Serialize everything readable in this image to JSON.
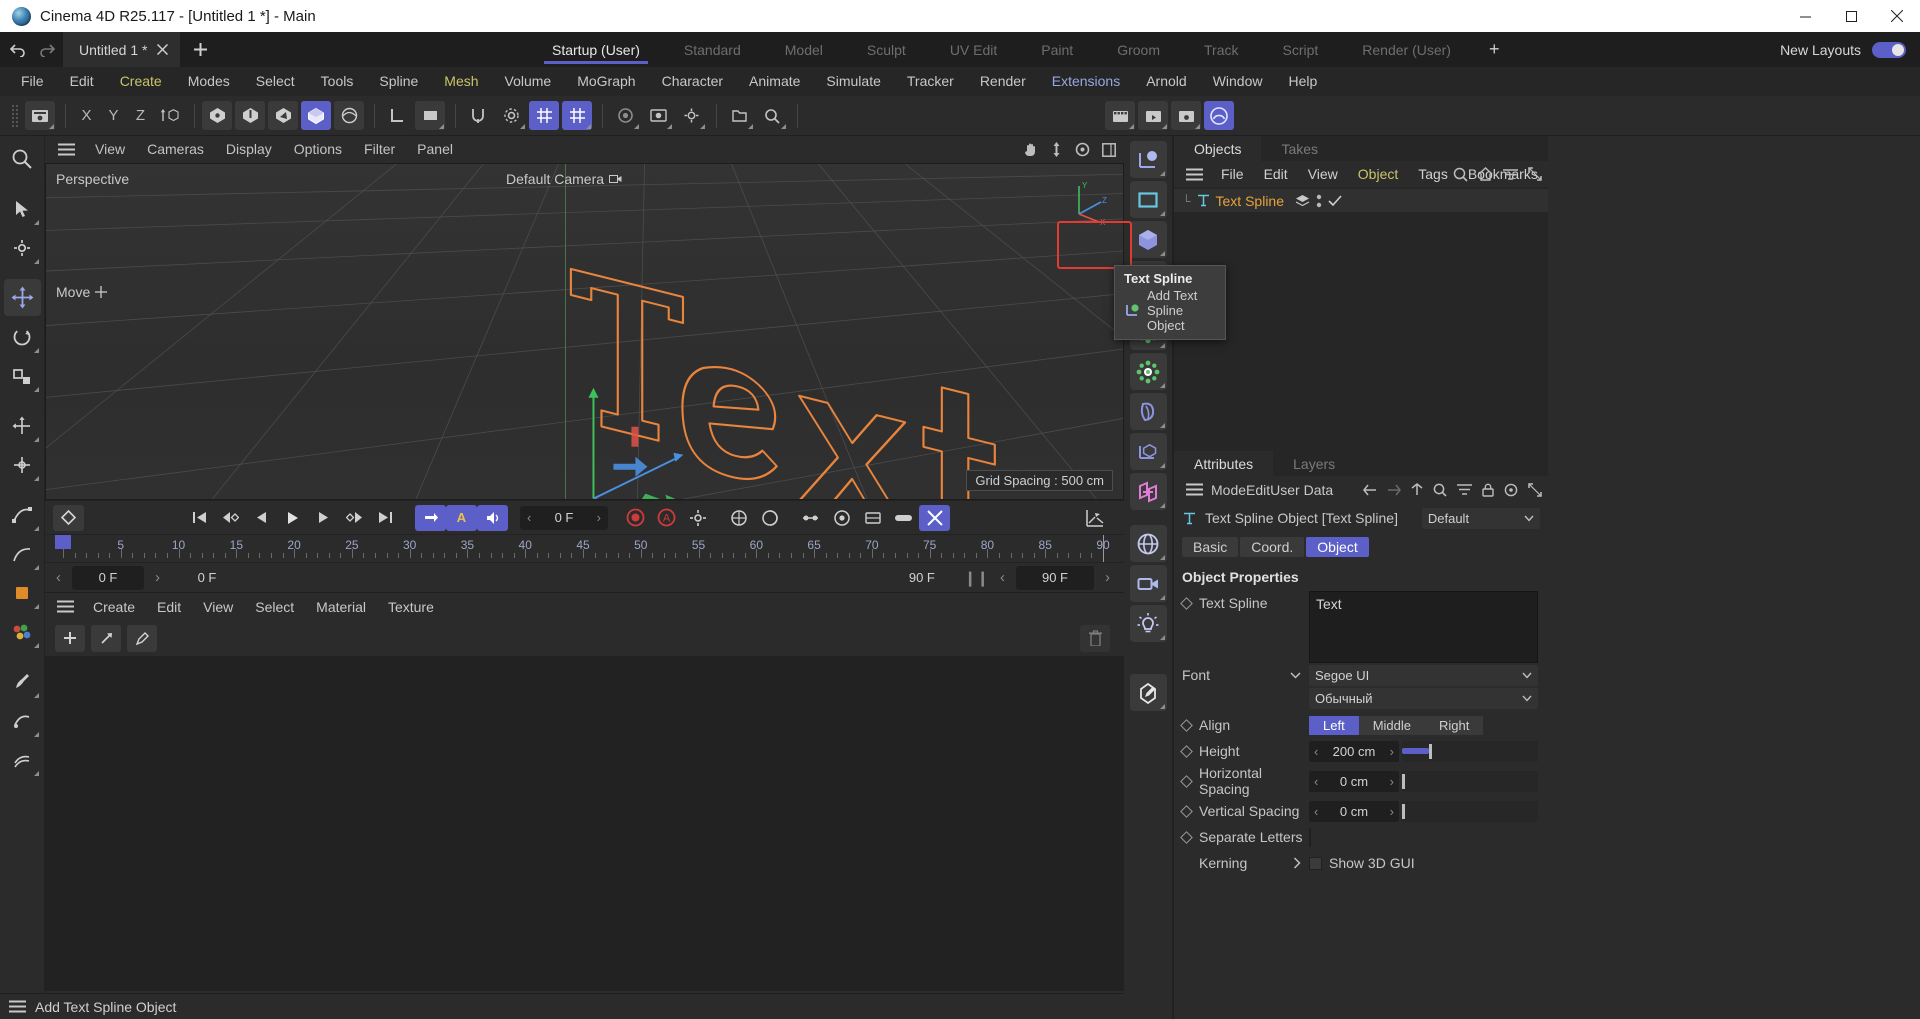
{
  "window": {
    "title": "Cinema 4D R25.117 - [Untitled 1 *] - Main",
    "logo_icon": "cinema4d-logo-icon",
    "minimize_icon": "minimize-icon",
    "maximize_icon": "maximize-icon",
    "close_icon": "close-icon"
  },
  "tabrow": {
    "undo_icon": "undo-icon",
    "redo_icon": "redo-icon",
    "document_tab": "Untitled 1 *",
    "document_close_icon": "close-icon",
    "new_tab_label": "+",
    "layouts": [
      {
        "label": "Startup (User)",
        "active": true
      },
      {
        "label": "Standard",
        "active": false
      },
      {
        "label": "Model",
        "active": false
      },
      {
        "label": "Sculpt",
        "active": false
      },
      {
        "label": "UV Edit",
        "active": false
      },
      {
        "label": "Paint",
        "active": false
      },
      {
        "label": "Groom",
        "active": false
      },
      {
        "label": "Track",
        "active": false
      },
      {
        "label": "Script",
        "active": false
      },
      {
        "label": "Render (User)",
        "active": false
      }
    ],
    "add_layout_label": "+",
    "new_layouts_label": "New Layouts",
    "toggle_on": true
  },
  "menubar": {
    "items": [
      {
        "label": "File",
        "color": "#c8c8c8"
      },
      {
        "label": "Edit",
        "color": "#c8c8c8"
      },
      {
        "label": "Create",
        "color": "#c9c46a"
      },
      {
        "label": "Modes",
        "color": "#c8c8c8"
      },
      {
        "label": "Select",
        "color": "#c8c8c8"
      },
      {
        "label": "Tools",
        "color": "#c8c8c8"
      },
      {
        "label": "Spline",
        "color": "#c8c8c8"
      },
      {
        "label": "Mesh",
        "color": "#c9c46a"
      },
      {
        "label": "Volume",
        "color": "#c8c8c8"
      },
      {
        "label": "MoGraph",
        "color": "#c8c8c8"
      },
      {
        "label": "Character",
        "color": "#c8c8c8"
      },
      {
        "label": "Animate",
        "color": "#c8c8c8"
      },
      {
        "label": "Simulate",
        "color": "#c8c8c8"
      },
      {
        "label": "Tracker",
        "color": "#c8c8c8"
      },
      {
        "label": "Render",
        "color": "#c8c8c8"
      },
      {
        "label": "Extensions",
        "color": "#9aa7e0"
      },
      {
        "label": "Arnold",
        "color": "#c8c8c8"
      },
      {
        "label": "Window",
        "color": "#c8c8c8"
      },
      {
        "label": "Help",
        "color": "#c8c8c8"
      }
    ]
  },
  "maintoolbar": {
    "axis_labels": [
      "X",
      "Y",
      "Z"
    ],
    "icons": [
      "undo-redo-icon",
      "live-selection-icon",
      "x-axis-lock",
      "y-axis-lock",
      "z-axis-lock",
      "world-object-axis-icon",
      "point-mode-icon",
      "edge-mode-icon",
      "polygon-mode-icon",
      "model-mode-icon",
      "texture-mode-icon",
      "workplane-icon",
      "locked-workplane-icon",
      "enable-axis-icon",
      "enable-snap-icon",
      "grid-snap-icon",
      "workplane-snap-icon",
      "render-view-icon",
      "render-to-picture-viewer-icon",
      "render-settings-icon",
      "content-browser-icon",
      "asset-browser-icon",
      "scene-nodes-icon",
      "add-render-icon",
      "render-queue-icon",
      "render-settings-gear-icon",
      "cineware-icon"
    ]
  },
  "viewport": {
    "menu": [
      "View",
      "Cameras",
      "Display",
      "Options",
      "Filter",
      "Panel"
    ],
    "hamburger_icon": "hamburger-icon",
    "right_icons": [
      "pan-icon",
      "dolly-icon",
      "rotate-icon",
      "maximize-viewport-icon"
    ],
    "label_top_left": "Perspective",
    "label_camera": "Default Camera",
    "camera_icon": "camera-icon",
    "move_label": "Move",
    "move_icon": "move-crosshair-icon",
    "grid_spacing": "Grid Spacing : 500 cm",
    "axis_labels": {
      "x": "X",
      "y": "Y",
      "z": "Z"
    },
    "text_object": "Text"
  },
  "timeline": {
    "keyframe_icon": "keyframe-diamond-icon",
    "transport_icons": [
      "go-to-start-icon",
      "go-to-previous-key-icon",
      "go-to-previous-frame-icon",
      "play-icon",
      "go-to-next-frame-icon",
      "go-to-next-key-icon",
      "go-to-end-icon"
    ],
    "loop_icon": "loop-icon",
    "autokey_letter": "A",
    "sound_icon": "sound-icon",
    "current_frame": "0 F",
    "record_icon": "record-active-objects-icon",
    "autokeying_icon": "autokeying-icon",
    "keyframe_settings_icon": "keyframe-settings-icon",
    "position_icon": "position-icon",
    "rotation_icon": "rotation-icon",
    "scale_icon": "scale-icon",
    "param_icon": "parameter-icon",
    "pla_icon": "point-level-animation-icon",
    "animation_layer_icon": "animation-layer-icon",
    "curve_icon": "curve-icon",
    "ruler_ticks": [
      "0",
      "5",
      "10",
      "15",
      "20",
      "25",
      "30",
      "35",
      "40",
      "45",
      "50",
      "55",
      "60",
      "65",
      "70",
      "75",
      "80",
      "85",
      "90"
    ],
    "start_frame": "0 F",
    "preview_start": "0 F",
    "end_frame": "90 F",
    "preview_end": "90 F"
  },
  "material": {
    "menu": [
      "Create",
      "Edit",
      "View",
      "Select",
      "Material",
      "Texture"
    ],
    "hamburger_icon": "hamburger-icon",
    "new_material_icon": "plus-icon",
    "apply_icon": "arrow-icon",
    "picker_icon": "eyedropper-icon",
    "delete_icon": "trash-icon",
    "view_list_icon": "list-view-icon",
    "view_grid_icon": "grid-view-icon",
    "view_large_icon": "large-icon-view-icon"
  },
  "objects_panel": {
    "tabs": [
      {
        "label": "Objects",
        "active": true
      },
      {
        "label": "Takes",
        "active": false
      }
    ],
    "menu": [
      "File",
      "Edit",
      "View",
      "Object",
      "Tags",
      "Bookmarks"
    ],
    "hamburger_icon": "hamburger-icon",
    "right_icons": [
      "search-icon",
      "home-icon",
      "filter-icon",
      "expand-icon"
    ],
    "items": [
      {
        "name": "Text Spline",
        "icon": "text-spline-icon",
        "layer_icon": "layer-icon",
        "visibility_dots_icon": "visibility-dots-icon",
        "check_icon": "check-icon"
      }
    ]
  },
  "attributes_panel": {
    "tabs": [
      {
        "label": "Attributes",
        "active": true
      },
      {
        "label": "Layers",
        "active": false
      }
    ],
    "menu": [
      "Mode",
      "Edit",
      "User Data"
    ],
    "hamburger_icon": "hamburger-icon",
    "right_icons": [
      "back-arrow-icon",
      "forward-arrow-icon",
      "up-arrow-icon",
      "search-icon",
      "filter-icon",
      "lock-icon",
      "pin-icon",
      "expand-icon"
    ],
    "object_icon": "text-spline-icon",
    "object_title": "Text Spline Object [Text Spline]",
    "mode_selector": "Default",
    "chevron_icon": "chevron-down-icon",
    "subtabs": [
      {
        "label": "Basic",
        "active": false
      },
      {
        "label": "Coord.",
        "active": false
      },
      {
        "label": "Object",
        "active": true
      }
    ],
    "section_title": "Object Properties",
    "properties": {
      "text_spline_label": "Text Spline",
      "text_spline_value": "Text",
      "font_label": "Font",
      "font_value": "Segoe UI",
      "font_style_value": "Обычный",
      "align_label": "Align",
      "align_options": [
        {
          "label": "Left",
          "active": true
        },
        {
          "label": "Middle",
          "active": false
        },
        {
          "label": "Right",
          "active": false
        }
      ],
      "height_label": "Height",
      "height_value": "200 cm",
      "height_slider_pct": 20,
      "horizontal_spacing_label": "Horizontal Spacing",
      "horizontal_spacing_value": "0 cm",
      "horizontal_spacing_pct": 0,
      "vertical_spacing_label": "Vertical Spacing",
      "vertical_spacing_value": "0 cm",
      "vertical_spacing_pct": 0,
      "separate_letters_label": "Separate Letters",
      "separate_letters_checked": false,
      "kerning_label": "Kerning",
      "kerning_chevron": "chevron-right-icon",
      "show_3d_gui_label": "Show 3D GUI",
      "show_3d_gui_checked": false
    }
  },
  "right_rail": {
    "icons": [
      "null-object-icon",
      "spline-pen-icon",
      "cube-primitive-icon",
      "text-spline-icon",
      "subdivision-surface-icon",
      "mograph-cloner-icon",
      "simulation-icon",
      "deformer-icon",
      "field-icon",
      "xpresso-icon",
      "environment-icon",
      "camera-icon",
      "light-icon",
      "sculpt-icon"
    ],
    "highlighted_index": 3
  },
  "tooltip": {
    "title": "Text Spline",
    "subtitle": "Add Text Spline Object",
    "icon": "text-spline-object-icon"
  },
  "statusbar": {
    "hamburger_icon": "hamburger-icon",
    "message": "Add Text Spline Object"
  }
}
